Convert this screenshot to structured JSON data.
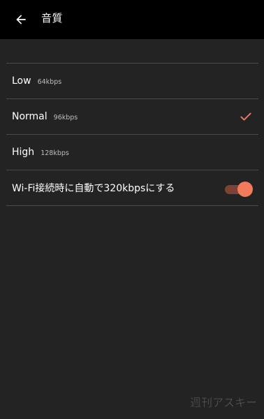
{
  "header": {
    "title": "音質",
    "back_icon": "arrow-left-icon"
  },
  "quality_options": [
    {
      "label": "Low",
      "bitrate": "64kbps",
      "selected": false
    },
    {
      "label": "Normal",
      "bitrate": "96kbps",
      "selected": true
    },
    {
      "label": "High",
      "bitrate": "128kbps",
      "selected": false
    }
  ],
  "wifi_setting": {
    "label": "Wi-Fi接続時に自動で320kbpsにする",
    "enabled": true
  },
  "colors": {
    "accent": "#f47a5c",
    "background": "#232323",
    "appbar": "#000000",
    "divider": "#4a4a4a"
  },
  "watermark": {
    "text": "週刊アスキー"
  }
}
